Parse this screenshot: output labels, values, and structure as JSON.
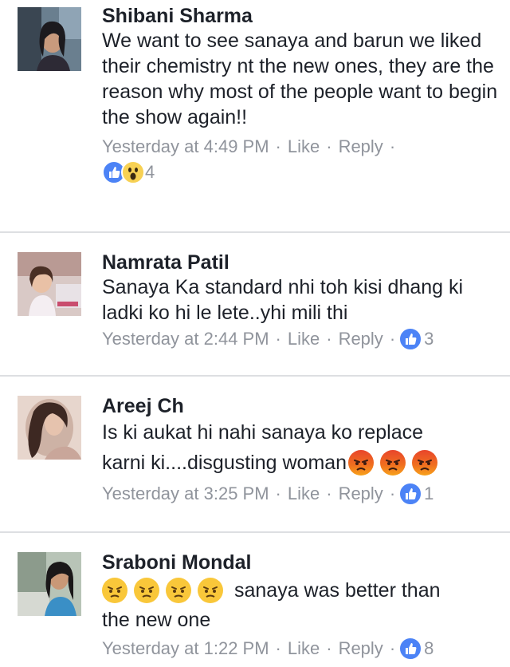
{
  "comments": [
    {
      "name": "Shibani Sharma",
      "text": "We want to see sanaya and barun we liked their chemistry nt the new ones, they are the reason why most of the people want to begin the show again!!",
      "time": "Yesterday at 4:49 PM",
      "like_label": "Like",
      "reply_label": "Reply",
      "reaction_count": "4",
      "reactions": [
        "like-icon",
        "wow-icon"
      ]
    },
    {
      "name": "Namrata Patil",
      "text": "Sanaya Ka standard nhi toh kisi dhang ki ladki ko hi le lete..yhi mili thi",
      "time": "Yesterday at 2:44 PM",
      "like_label": "Like",
      "reply_label": "Reply",
      "reaction_count": "3",
      "reactions": [
        "like-icon"
      ]
    },
    {
      "name": "Areej Ch",
      "text_line1": "Is ki aukat hi nahi sanaya ko replace",
      "text_line2": "karni ki....disgusting woman",
      "emojis": [
        "angry-face-icon",
        "angry-face-icon",
        "angry-face-icon"
      ],
      "time": "Yesterday at 3:25 PM",
      "like_label": "Like",
      "reply_label": "Reply",
      "reaction_count": "1",
      "reactions": [
        "like-icon"
      ]
    },
    {
      "name": "Sraboni Mondal",
      "emojis": [
        "annoyed-face-icon",
        "annoyed-face-icon",
        "annoyed-face-icon",
        "annoyed-face-icon"
      ],
      "text_after_emojis": "sanaya was better than",
      "text_line2": "the new one",
      "time": "Yesterday at 1:22 PM",
      "like_label": "Like",
      "reply_label": "Reply",
      "reaction_count": "8",
      "reactions": [
        "like-icon"
      ]
    }
  ],
  "colors": {
    "like_blue": "#4c83f6",
    "meta_gray": "#90949c",
    "divider": "#dddfe2"
  }
}
